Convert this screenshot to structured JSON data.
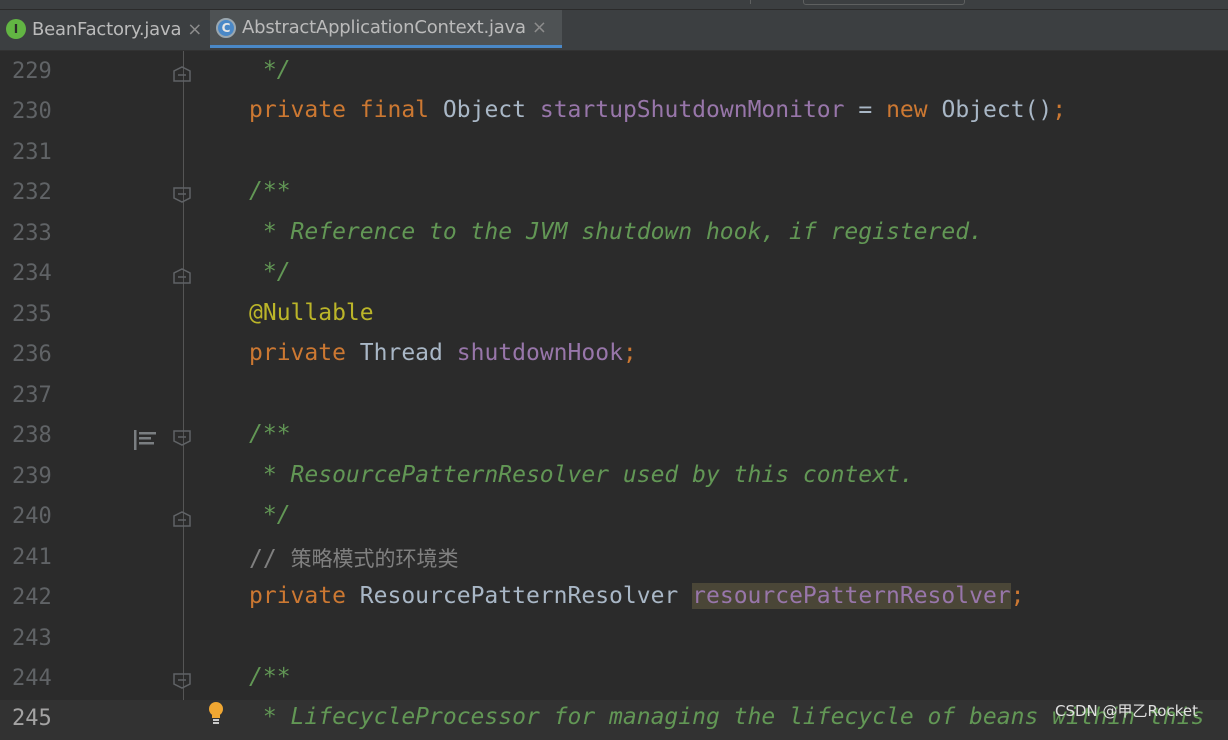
{
  "tabs": [
    {
      "icon": "interface-icon",
      "icon_letter": "I",
      "label": "BeanFactory.java",
      "close": "×",
      "active": false
    },
    {
      "icon": "class-icon",
      "icon_letter": "C",
      "label": "AbstractApplicationContext.java",
      "close": "×",
      "active": true
    }
  ],
  "lines": {
    "l229": {
      "num": "229",
      "text": " */"
    },
    "l230": {
      "num": "230",
      "kw1": "private",
      "kw2": "final",
      "type": "Object",
      "field": "startupShutdownMonitor",
      "eq": "=",
      "kw3": "new",
      "ctor": "Object()",
      "semi": ";"
    },
    "l231": {
      "num": "231"
    },
    "l232": {
      "num": "232",
      "text": "/**"
    },
    "l233": {
      "num": "233",
      "text": " * Reference to the JVM shutdown hook, if registered."
    },
    "l234": {
      "num": "234",
      "text": " */"
    },
    "l235": {
      "num": "235",
      "text": "@Nullable"
    },
    "l236": {
      "num": "236",
      "kw1": "private",
      "type": "Thread",
      "field": "shutdownHook",
      "semi": ";"
    },
    "l237": {
      "num": "237"
    },
    "l238": {
      "num": "238",
      "text": "/**"
    },
    "l239": {
      "num": "239",
      "text": " * ResourcePatternResolver used by this context."
    },
    "l240": {
      "num": "240",
      "text": " */"
    },
    "l241": {
      "num": "241",
      "slashes": "//",
      "text": "策略模式的环境类"
    },
    "l242": {
      "num": "242",
      "kw1": "private",
      "type": "ResourcePatternResolver",
      "field": "resourcePatternResolver",
      "semi": ";"
    },
    "l243": {
      "num": "243"
    },
    "l244": {
      "num": "244",
      "text": "/**"
    },
    "l245": {
      "num": "245",
      "text": " * LifecycleProcessor for managing the lifecycle of beans within this"
    }
  },
  "watermark": "CSDN @甲乙Rocket",
  "colors": {
    "background": "#2b2b2b",
    "keyword": "#cc7832",
    "field": "#9876aa",
    "annotation": "#bbb529",
    "doc_comment": "#629755",
    "line_comment": "#808080",
    "line_number": "#606366",
    "identifier_highlight": "#4a4637",
    "active_tab_underline": "#4a88c7"
  }
}
